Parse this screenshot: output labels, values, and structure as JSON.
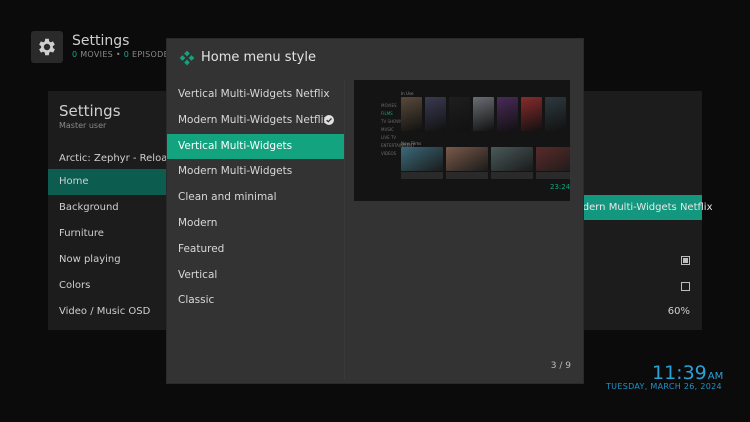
{
  "topbar": {
    "title": "Settings",
    "movies_count": "0",
    "movies_label": "MOVIES",
    "separator": "•",
    "episodes_count": "0",
    "episodes_label": "EPISODE"
  },
  "bg_panel": {
    "title": "Settings",
    "subtitle": "Master user",
    "skin_label": "Arctic: Zephyr - Reloaded",
    "items": [
      {
        "label": "Home"
      },
      {
        "label": "Background"
      },
      {
        "label": "Furniture"
      },
      {
        "label": "Now playing"
      },
      {
        "label": "Colors"
      },
      {
        "label": "Video / Music OSD"
      }
    ],
    "selected_value": "Modern Multi-Widgets Netflix",
    "now_playing_checked": true,
    "colors_checked": false,
    "osd_value": "60%"
  },
  "clock": {
    "time": "11:39",
    "ampm": "AM",
    "date": "TUESDAY, MARCH 26, 2024"
  },
  "dialog": {
    "title": "Home menu style",
    "counter": "3 / 9",
    "accent": "#13a37f",
    "options": [
      {
        "label": "Vertical Multi-Widgets Netflix"
      },
      {
        "label": "Modern Multi-Widgets Netflix",
        "current": true
      },
      {
        "label": "Vertical Multi-Widgets",
        "selected": true
      },
      {
        "label": "Modern Multi-Widgets"
      },
      {
        "label": "Clean and minimal"
      },
      {
        "label": "Modern"
      },
      {
        "label": "Featured"
      },
      {
        "label": "Vertical"
      },
      {
        "label": "Classic"
      }
    ],
    "preview": {
      "menu": [
        "MOVIES",
        "FILMS",
        "TV SHOWS",
        "MUSIC",
        "LIVE TV",
        "ENTERTAINMENT",
        "VIDEOS"
      ],
      "active_menu": 1,
      "row1_label": "In Use",
      "row2_label": "New Films",
      "poster_colors": [
        "#5a4a3a",
        "#3b3a52",
        "#1e1e1e",
        "#6a6e74",
        "#4a2a5a",
        "#8a2b2b",
        "#2d3a3f"
      ],
      "wide_colors": [
        "#3a6a7a",
        "#7a5a4a",
        "#4a5a5a",
        "#5a2a2a"
      ],
      "time": "23:24"
    }
  }
}
